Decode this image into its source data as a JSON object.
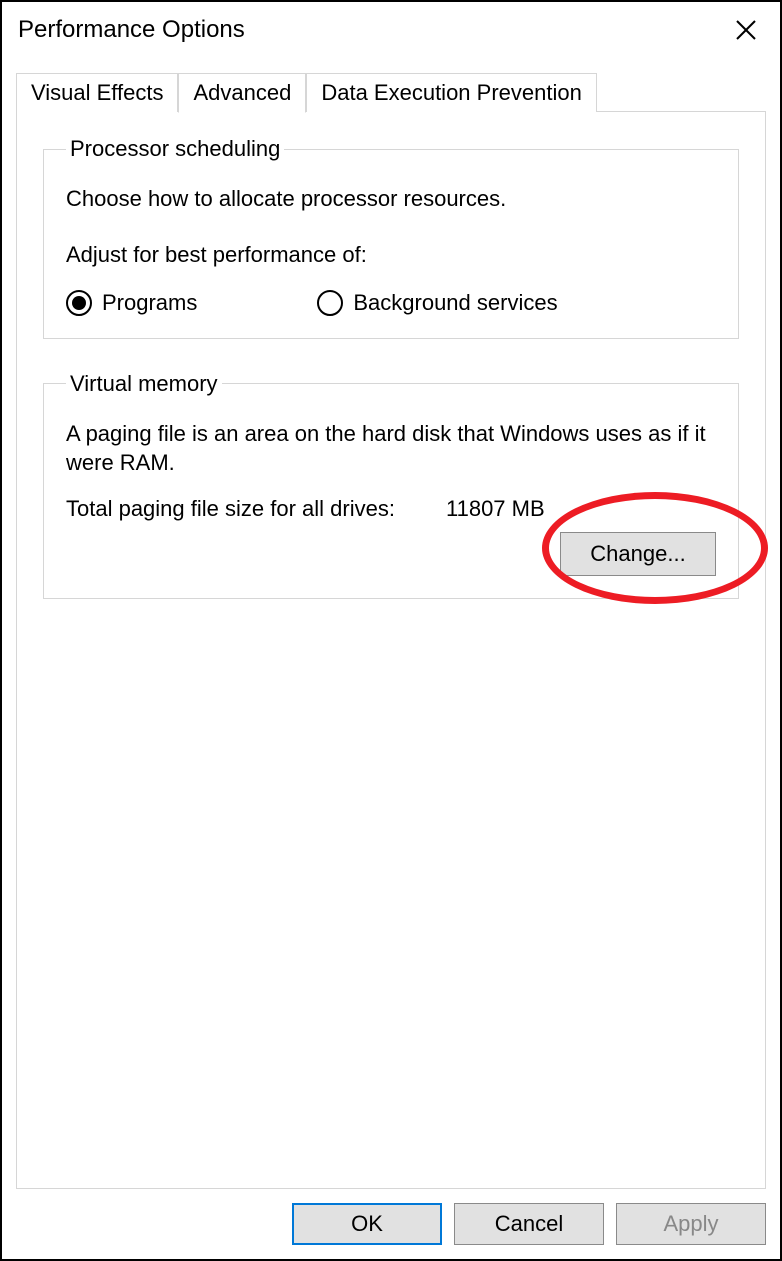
{
  "window": {
    "title": "Performance Options"
  },
  "tabs": {
    "visual_effects": "Visual Effects",
    "advanced": "Advanced",
    "dep": "Data Execution Prevention"
  },
  "processor": {
    "legend": "Processor scheduling",
    "description": "Choose how to allocate processor resources.",
    "adjust_label": "Adjust for best performance of:",
    "programs_label": "Programs",
    "background_label": "Background services",
    "selected": "programs"
  },
  "virtual_memory": {
    "legend": "Virtual memory",
    "description": "A paging file is an area on the hard disk that Windows uses as if it were RAM.",
    "total_label": "Total paging file size for all drives:",
    "total_value": "11807 MB",
    "change_button": "Change..."
  },
  "buttons": {
    "ok": "OK",
    "cancel": "Cancel",
    "apply": "Apply"
  }
}
